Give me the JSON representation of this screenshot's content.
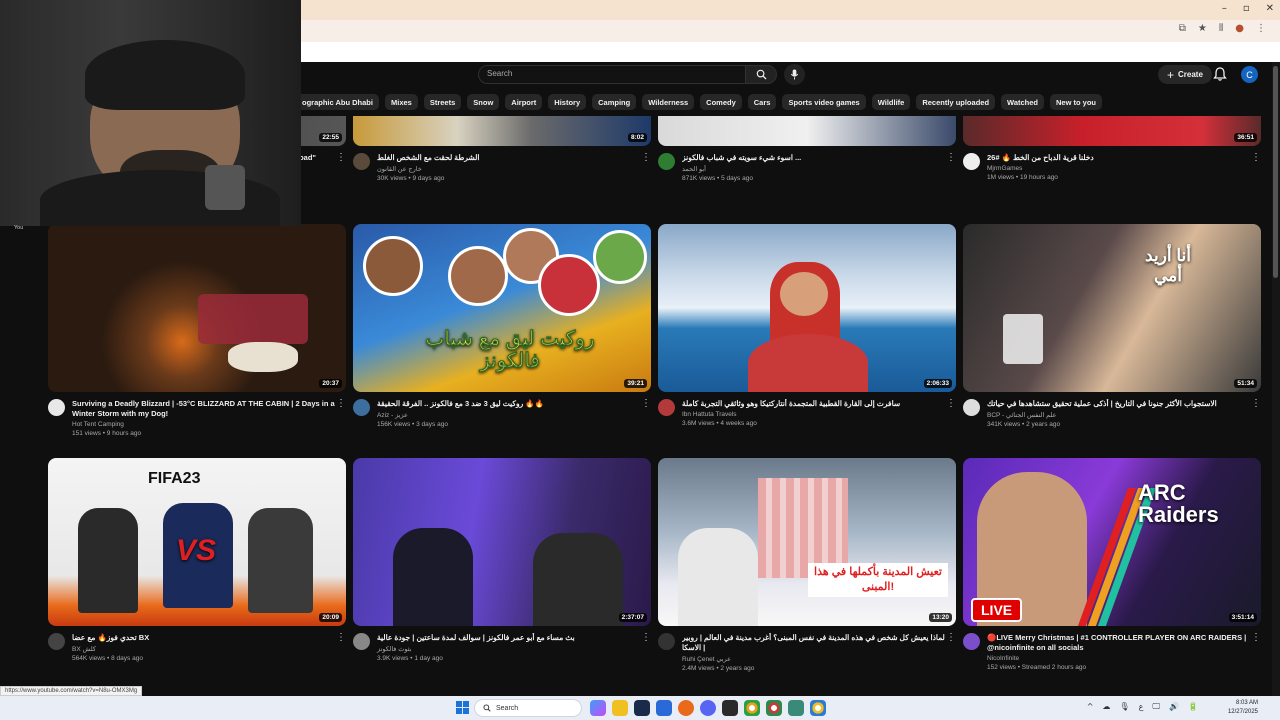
{
  "window": {
    "controls": [
      "–",
      "▫",
      "✕"
    ],
    "toolbar_icons": [
      "⧉",
      "★",
      "⦀",
      "●",
      "⋮"
    ]
  },
  "youtube": {
    "search_placeholder": "Search",
    "create_label": "Create",
    "avatar_letter": "C",
    "chips": [
      "ographic Abu Dhabi",
      "Mixes",
      "Streets",
      "Snow",
      "Airport",
      "History",
      "Camping",
      "Wilderness",
      "Comedy",
      "Cars",
      "Sports video games",
      "Wildlife",
      "Recently uploaded",
      "Watched",
      "New to you"
    ]
  },
  "webcam": {
    "label": "You"
  },
  "row1": [
    {
      "title": "...oad\"",
      "channel": "",
      "stats": "",
      "duration": "22:55",
      "avatar_color": "#333333"
    },
    {
      "title": "الشرطة لحقت مع الشخص الغلط",
      "channel": "خارج عن القانون",
      "stats": "30K views • 9 days ago",
      "duration": "8:02",
      "avatar_color": "#5a4a3a"
    },
    {
      "title": "اسوء شيء سويته في شباب فالكونز ...",
      "channel": "أبو الحمد",
      "stats": "871K views • 5 days ago",
      "duration": "",
      "avatar_color": "#2e7d32"
    },
    {
      "title": "دخلنا قرية الدباح من الخط 🔥 #26",
      "channel": "MjrmGames",
      "stats": "1M views • 19 hours ago",
      "duration": "36:51",
      "avatar_color": "#eeeeee"
    }
  ],
  "row2": [
    {
      "title": "Surviving a Deadly Blizzard | -53°C BLIZZARD AT THE CABIN | 2 Days in a Winter Storm with my Dog!",
      "channel": "Hot Tent Camping",
      "stats": "151 views • 9 hours ago",
      "duration": "20:37",
      "avatar_color": "#e8e8e8"
    },
    {
      "title": "روكيت ليق 3 ضد 3 مع فالكونز .. الفرقة الحقيقة 🔥🔥",
      "channel": "Aziz - عزيز",
      "stats": "156K views • 3 days ago",
      "duration": "39:21",
      "avatar_color": "#3c6e9f",
      "overlay": "روكيت ليق مع شباب فالكونز"
    },
    {
      "title": "سافرت إلى القارة القطبية المتجمدة أنتاركتيكا وهو وثائقي التجربة كاملة",
      "channel": "Ibn Hattuta Travels",
      "stats": "3.6M views • 4 weeks ago",
      "duration": "2:06:33",
      "avatar_color": "#b23a3a"
    },
    {
      "title": "الاستجواب الأكثر جنونا في التاريخ | أذكى عملية تحقيق ستشاهدها في حياتك",
      "channel": "BCP - علم النفس الجنائي",
      "stats": "341K views • 2 years ago",
      "duration": "51:34",
      "avatar_color": "#dddddd",
      "overlay": "أنا أريد أمي"
    }
  ],
  "row3": [
    {
      "title": "تحدي فوز🔥 مع عضا BX",
      "channel": "BX كلش",
      "stats": "564K views • 8 days ago",
      "duration": "20:09",
      "avatar_color": "#444444",
      "overlay": "FIFA23"
    },
    {
      "title": "بث مساء مع أبو عمر فالكونز | سوالف لمدة ساعتين | جودة عالية",
      "channel": "بثوث فالكونز",
      "stats": "3.9K views • 1 day ago",
      "duration": "2:37:07",
      "avatar_color": "#888888"
    },
    {
      "title": "لماذا يعيش كل شخص في هذه المدينة في نفس المبنى؟ أغرب مدينة في العالم | روبير | الاسكا",
      "channel": "Ruhi Çenet عربي",
      "stats": "2.4M views • 2 years ago",
      "duration": "13:20",
      "avatar_color": "#333333",
      "overlay": "تعيش المدينة بأكملها في هذا المبنى!"
    },
    {
      "title": "🔴LIVE Merry Christmas | #1 CONTROLLER PLAYER ON ARC RAIDERS | @nicoinfinite on all socials",
      "channel": "NicoInfinite",
      "stats": "152 views • Streamed 2 hours ago",
      "duration": "3:51:14",
      "avatar_color": "#7b4fc9",
      "overlay": "ARC Raiders",
      "live": "LIVE"
    }
  ],
  "status_url": "https://www.youtube.com/watch?v=N8u-OMX3Mg",
  "taskbar": {
    "search_label": "Search",
    "time": "8:03 AM",
    "date": "12/27/2025",
    "tray": [
      "^",
      "☁",
      "🎙",
      "ع",
      "🖵",
      "🔊",
      "🔋"
    ]
  },
  "colors": {
    "accent": "#1565c0",
    "live_red": "#e00000"
  }
}
